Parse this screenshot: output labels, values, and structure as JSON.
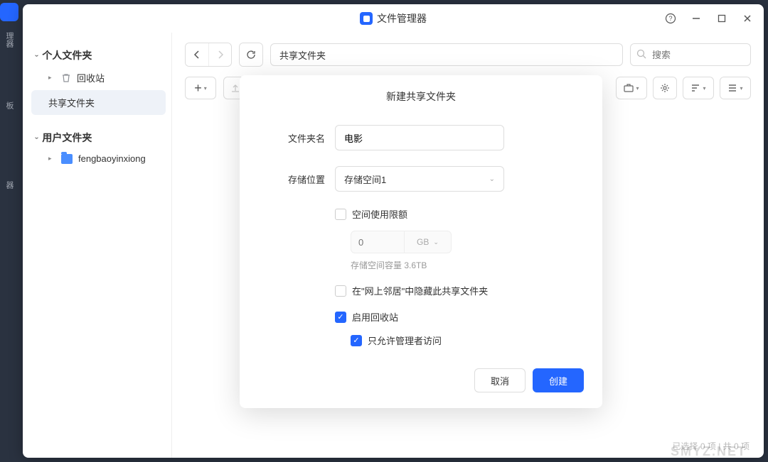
{
  "app": {
    "title": "文件管理器"
  },
  "dock": {
    "items": [
      "理器",
      "板",
      "器"
    ]
  },
  "sidebar": {
    "section1": {
      "title": "个人文件夹"
    },
    "recycle": {
      "label": "回收站"
    },
    "shared": {
      "label": "共享文件夹"
    },
    "section2": {
      "title": "用户文件夹"
    },
    "user": {
      "label": "fengbaoyinxiong"
    }
  },
  "topbar": {
    "path": "共享文件夹",
    "search_placeholder": "搜索"
  },
  "modal": {
    "title": "新建共享文件夹",
    "name_label": "文件夹名",
    "name_value": "电影",
    "location_label": "存储位置",
    "location_value": "存储空间1",
    "quota_check": "空间使用限额",
    "quota_placeholder": "0",
    "quota_unit": "GB",
    "capacity_hint": "存储空间容量 3.6TB",
    "hide_check": "在\"网上邻居\"中隐藏此共享文件夹",
    "recycle_check": "启用回收站",
    "admin_check": "只允许管理者访问",
    "cancel": "取消",
    "create": "创建",
    "state": {
      "quota_enabled": false,
      "hide_enabled": false,
      "recycle_enabled": true,
      "admin_only": true
    }
  },
  "statusbar": "已选择 0 项 | 共 0 项",
  "watermark": "SMYZ.NET"
}
